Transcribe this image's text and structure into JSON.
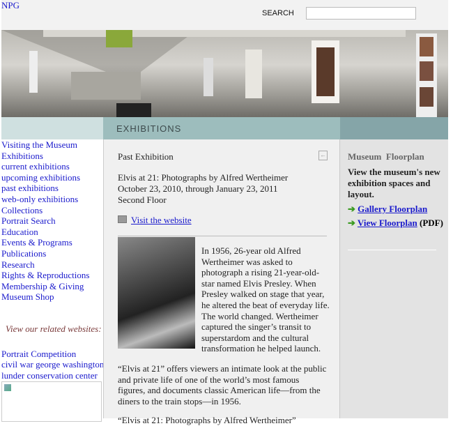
{
  "header": {
    "logo": "NPG",
    "search_label": "SEARCH",
    "search_value": ""
  },
  "nav": {
    "section_title": "EXHIBITIONS"
  },
  "sidebar": {
    "items": [
      "Visiting the Museum",
      "Exhibitions",
      "current exhibitions",
      "upcoming exhibitions",
      "past exhibitions",
      "web-only exhibitions",
      "Collections",
      "Portrait Search",
      "Education",
      "Events & Programs",
      "Publications",
      "Research",
      "Rights & Reproductions",
      "Membership & Giving",
      "Museum Shop"
    ],
    "related_heading": "View our related websites:",
    "related": [
      "Portrait Competition",
      "civil war george washington",
      "lunder conservation center"
    ]
  },
  "main": {
    "kicker": "Past Exhibition",
    "title": "Elvis at 21: Photographs by Alfred Wertheimer",
    "dates": "October 23, 2010, through January 23, 2011",
    "location": "Second Floor",
    "website_link": "Visit the website",
    "para1": "In 1956, 26-year old Alfred Wertheimer was asked to photograph a rising 21-year-old-star named Elvis Presley. When Presley walked on stage that year, he altered the beat of everyday life. The world changed. Wertheimer captured the singer’s transit to superstardom and the cultural transformation he helped launch.",
    "para2": "“Elvis at 21” offers viewers an intimate look at the public and private life of one of the world’s most famous figures, and documents classic American life—from the diners to the train stops—in 1956.",
    "para3": "“Elvis at 21: Photographs by Alfred Wertheimer”"
  },
  "aside": {
    "heading": "Museum  Floorplan",
    "desc": "View the museum's new exhibition spaces and layout.",
    "link1": "Gallery Floorplan",
    "link2": "View Floorplan",
    "link2_suffix": "(PDF)"
  }
}
